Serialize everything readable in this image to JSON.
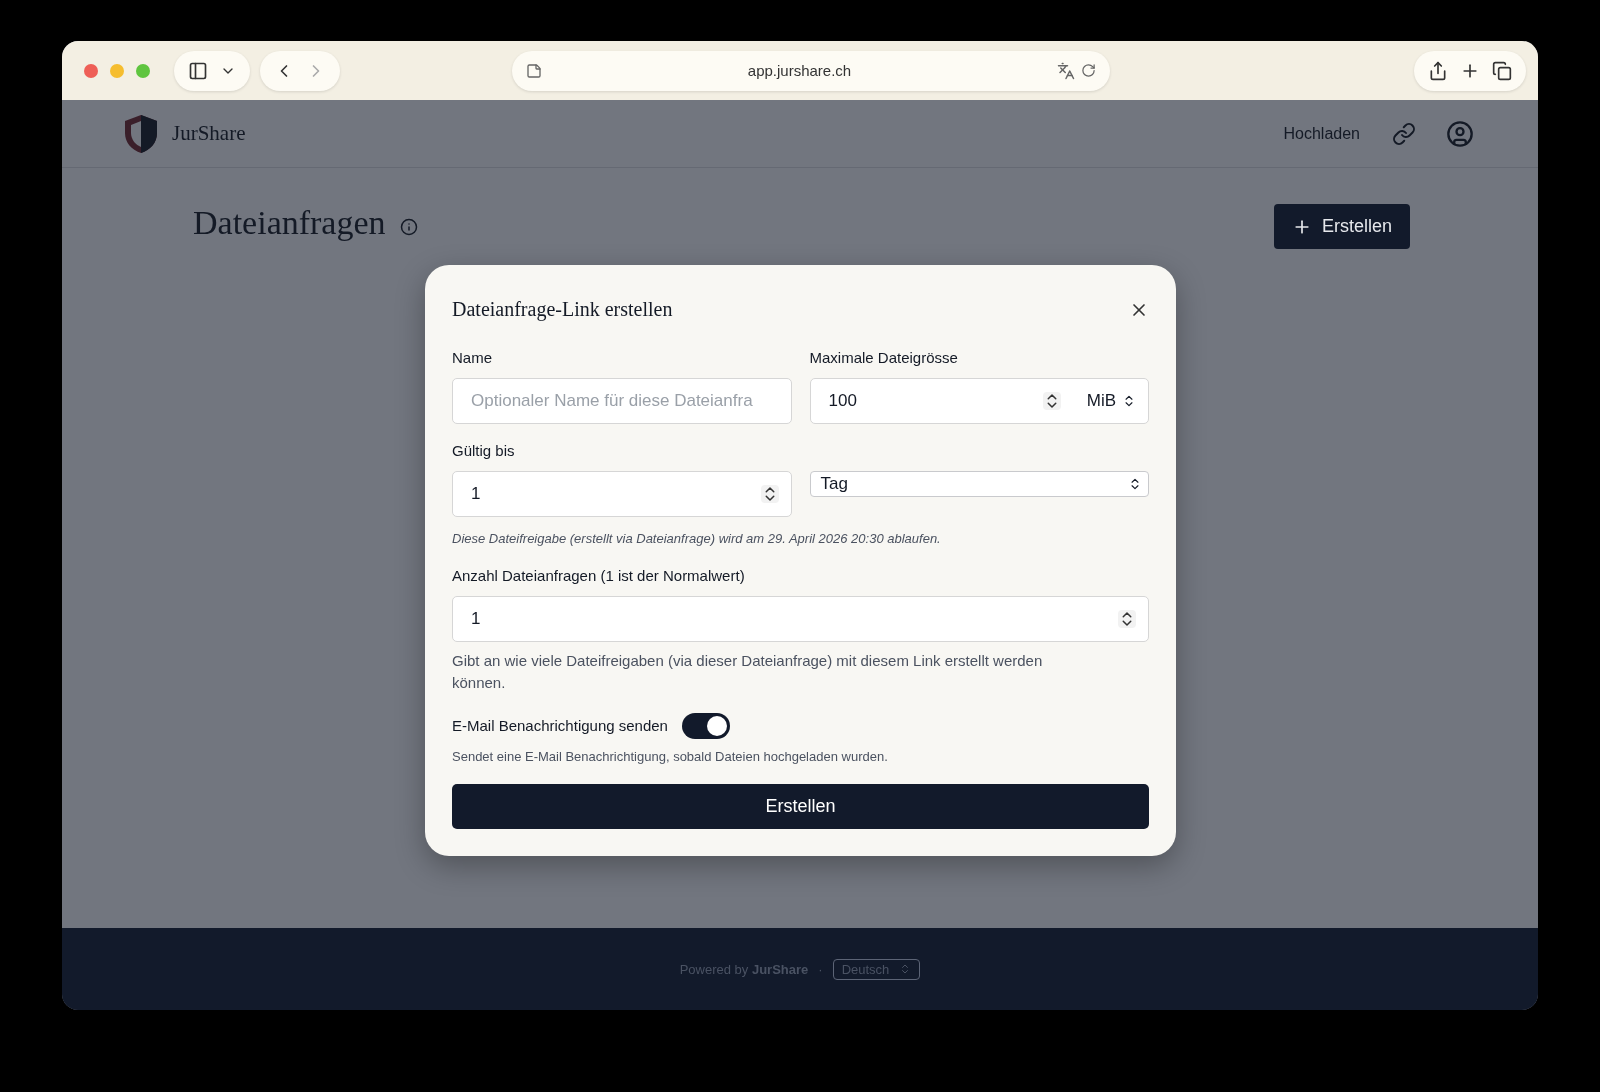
{
  "browser": {
    "url": "app.jurshare.ch"
  },
  "header": {
    "brand": "JurShare",
    "nav_link": "Hochladen"
  },
  "page": {
    "title": "Dateianfragen",
    "create_button": "Erstellen"
  },
  "dialog": {
    "title": "Dateianfrage-Link erstellen",
    "name": {
      "label": "Name",
      "placeholder": "Optionaler Name für diese Dateianfra"
    },
    "max_size": {
      "label": "Maximale Dateigrösse",
      "value": "100",
      "unit": "MiB"
    },
    "valid_until": {
      "label": "Gültig bis",
      "value": "1",
      "unit": "Tag",
      "hint": "Diese Dateifreigabe (erstellt via Dateianfrage) wird am 29. April 2026 20:30 ablaufen."
    },
    "count": {
      "label": "Anzahl Dateianfragen (1 ist der Normalwert)",
      "value": "1",
      "hint": "Gibt an wie viele Dateifreigaben (via dieser Dateianfrage) mit diesem Link erstellt werden können."
    },
    "notify": {
      "label": "E-Mail Benachrichtigung senden",
      "on": true,
      "hint": "Sendet eine E-Mail Benachrichtigung, sobald Dateien hochgeladen wurden."
    },
    "submit": "Erstellen"
  },
  "footer": {
    "powered": "Powered by **JurShare**",
    "separator": "·",
    "language": "Deutsch"
  }
}
